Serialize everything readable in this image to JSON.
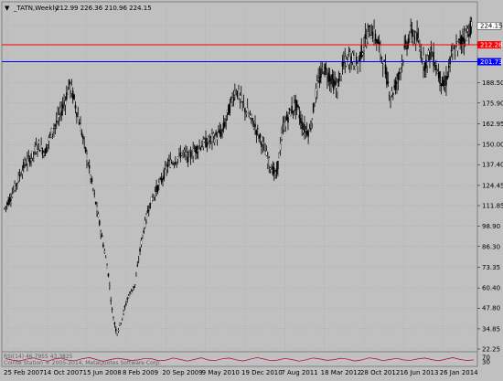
{
  "header": {
    "dropdown_glyph": "▼",
    "symbol_label": "_TATN,Weekly",
    "ohlc_text": "212.99 226.36 210.96 224.15"
  },
  "colors": {
    "background": "#c0c0c0",
    "plot_background": "#c0c0c0",
    "grid": "#a0a0a0",
    "candle": "#000000",
    "red_line": "#ff0000",
    "blue_line": "#0000ff",
    "current_price_tag": "#ffffff",
    "oscillator_line_1": "#c00000",
    "oscillator_line_2": "#c0c0ff"
  },
  "watermark": {
    "line1": "RSI(14) 46.7955 43.3825",
    "line2": "Coirite Station ® 2005-2014, MetaQuotes Software Corp."
  },
  "chart_data": {
    "type": "candlestick",
    "title": "_TATN,Weekly",
    "ohlc_last": {
      "open": 212.99,
      "high": 226.36,
      "low": 210.96,
      "close": 224.15
    },
    "y_ticks": [
      22.25,
      34.85,
      47.8,
      60.4,
      73.35,
      86.3,
      98.9,
      111.85,
      124.45,
      137.4,
      150.0,
      162.95,
      175.9,
      188.5,
      201.73,
      212.28,
      224.15
    ],
    "ylim": [
      22.25,
      230
    ],
    "x_tick_labels": [
      "25 Feb 2007",
      "14 Oct 2007",
      "15 Jun 2008",
      "8 Feb 2009",
      "20 Sep 2009",
      "9 May 2010",
      "19 Dec 2010",
      "7 Aug 2011",
      "18 Mar 2012",
      "28 Oct 2012",
      "16 Jun 2013",
      "26 Jan 2014"
    ],
    "horizontal_lines": [
      {
        "label": "212.28",
        "value": 212.28,
        "color": "#ff0000"
      },
      {
        "label": "201.73",
        "value": 201.73,
        "color": "#0000ff"
      }
    ],
    "current_price": {
      "label": "224.15",
      "value": 224.15
    },
    "price_path": [
      [
        0,
        110
      ],
      [
        3,
        118
      ],
      [
        6,
        128
      ],
      [
        9,
        138
      ],
      [
        12,
        142
      ],
      [
        15,
        150
      ],
      [
        18,
        145
      ],
      [
        21,
        158
      ],
      [
        24,
        166
      ],
      [
        27,
        178
      ],
      [
        29,
        188
      ],
      [
        31,
        178
      ],
      [
        34,
        160
      ],
      [
        37,
        140
      ],
      [
        40,
        118
      ],
      [
        43,
        95
      ],
      [
        46,
        72
      ],
      [
        48,
        45
      ],
      [
        50,
        32
      ],
      [
        52,
        40
      ],
      [
        55,
        55
      ],
      [
        58,
        62
      ],
      [
        61,
        90
      ],
      [
        64,
        110
      ],
      [
        67,
        120
      ],
      [
        70,
        128
      ],
      [
        73,
        138
      ],
      [
        76,
        140
      ],
      [
        79,
        145
      ],
      [
        82,
        142
      ],
      [
        85,
        147
      ],
      [
        88,
        150
      ],
      [
        91,
        152
      ],
      [
        94,
        155
      ],
      [
        97,
        158
      ],
      [
        100,
        172
      ],
      [
        103,
        185
      ],
      [
        106,
        175
      ],
      [
        109,
        168
      ],
      [
        112,
        160
      ],
      [
        115,
        150
      ],
      [
        118,
        138
      ],
      [
        121,
        130
      ],
      [
        124,
        160
      ],
      [
        127,
        170
      ],
      [
        130,
        175
      ],
      [
        133,
        160
      ],
      [
        136,
        158
      ],
      [
        139,
        185
      ],
      [
        142,
        198
      ],
      [
        145,
        192
      ],
      [
        148,
        185
      ],
      [
        151,
        200
      ],
      [
        154,
        205
      ],
      [
        157,
        200
      ],
      [
        160,
        212
      ],
      [
        163,
        222
      ],
      [
        166,
        215
      ],
      [
        169,
        200
      ],
      [
        172,
        180
      ],
      [
        175,
        190
      ],
      [
        178,
        208
      ],
      [
        181,
        220
      ],
      [
        184,
        215
      ],
      [
        187,
        200
      ],
      [
        190,
        208
      ],
      [
        193,
        195
      ],
      [
        196,
        185
      ],
      [
        199,
        205
      ],
      [
        202,
        212
      ],
      [
        205,
        218
      ],
      [
        208,
        224
      ]
    ],
    "oscillator": {
      "upper_bound": 70,
      "lower_bound": 30,
      "values": [
        58,
        45,
        38,
        52,
        64,
        48,
        36,
        55,
        62,
        44,
        40,
        57,
        66,
        50,
        35,
        49,
        61,
        53,
        42,
        47,
        60,
        55,
        39,
        45,
        63,
        51,
        37,
        50,
        65,
        46,
        41,
        56,
        62,
        48,
        38,
        52,
        67,
        54,
        40,
        46,
        59,
        50,
        36,
        48,
        63,
        55,
        43,
        49,
        61,
        52,
        38,
        47,
        64,
        57,
        41,
        50,
        60,
        46,
        44,
        55,
        62,
        49,
        39,
        53,
        66,
        51,
        42,
        47
      ]
    }
  }
}
